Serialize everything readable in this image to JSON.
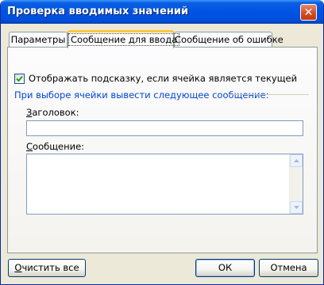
{
  "window": {
    "title": "Проверка вводимых значений",
    "close_glyph": "✕"
  },
  "tabs": [
    {
      "label": "Параметры"
    },
    {
      "label": "Сообщение для ввода"
    },
    {
      "label": "Сообщение об ошибке"
    }
  ],
  "input_message": {
    "show_tooltip_label": "Отображать подсказку, если ячейка является текущей",
    "show_tooltip_checked": true,
    "group_label": "При выборе ячейки вывести следующее сообщение:",
    "title_label_first": "З",
    "title_label_rest": "аголовок:",
    "title_value": "",
    "message_label_first": "С",
    "message_label_rest": "ообщение:",
    "message_value": ""
  },
  "buttons": {
    "clear_all_first": "О",
    "clear_all_rest": "чистить все",
    "ok": "ОК",
    "cancel": "Отмена"
  },
  "colors": {
    "titlebar": "#0054e3",
    "tab_highlight": "#ffc73c",
    "group_text": "#0046d5",
    "dialog_bg": "#ece9d8"
  }
}
